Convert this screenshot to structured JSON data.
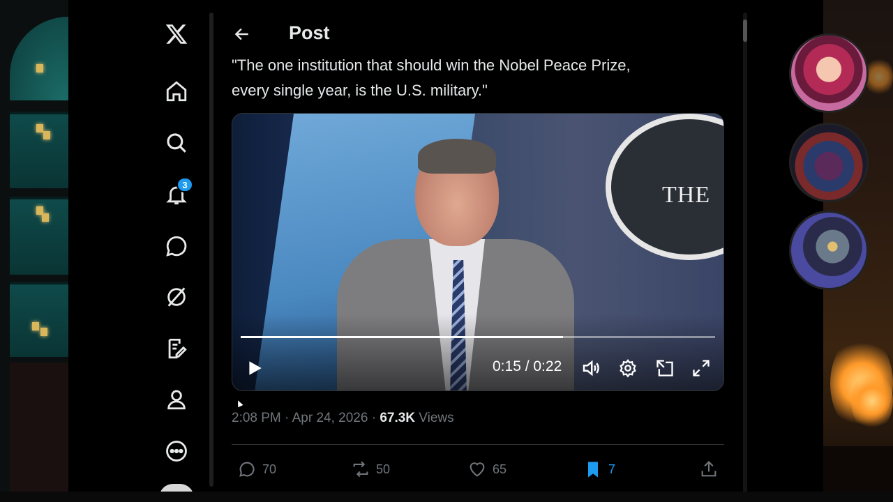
{
  "app": {
    "logo": "X"
  },
  "header": {
    "title": "Post",
    "back_icon": "arrow-left-icon"
  },
  "nav": {
    "items": [
      {
        "icon": "home-icon"
      },
      {
        "icon": "search-icon"
      },
      {
        "icon": "bell-icon",
        "badge": "3"
      },
      {
        "icon": "chat-bubble-icon"
      },
      {
        "icon": "grok-icon"
      },
      {
        "icon": "compose-icon"
      },
      {
        "icon": "profile-icon"
      },
      {
        "icon": "more-icon"
      }
    ]
  },
  "post": {
    "text_line1": "\"The one institution that should win the Nobel Peace Prize,",
    "text_line2": "every single year, is the U.S. military.\"",
    "time": "2:08 PM",
    "date": "Apr 24, 2026",
    "views_count": "67.3K",
    "views_label": "Views",
    "sep": "·"
  },
  "video": {
    "time_display": "0:15 / 0:22",
    "progress_fraction": 0.68,
    "backdrop_text": "THE",
    "controls": [
      "play-icon",
      "volume-icon",
      "settings-icon",
      "pip-icon",
      "fullscreen-icon"
    ]
  },
  "actions": {
    "replies": "70",
    "reposts": "50",
    "likes": "65",
    "bookmarks": "7"
  },
  "colors": {
    "accent": "#1d9bf0",
    "muted": "#71767b",
    "text": "#e7e9ea",
    "background": "#000000"
  }
}
